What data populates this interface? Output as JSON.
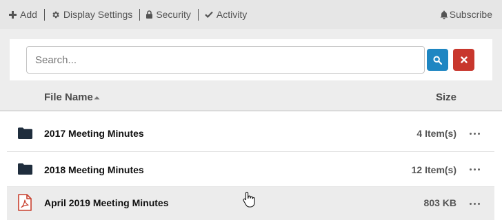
{
  "toolbar": {
    "add_label": "Add",
    "display_settings_label": "Display Settings",
    "security_label": "Security",
    "activity_label": "Activity",
    "subscribe_label": "Subscribe",
    "icons": [
      "plus-icon",
      "gear-icon",
      "lock-icon",
      "check-icon",
      "bell-icon"
    ]
  },
  "search": {
    "placeholder": "Search...",
    "value": ""
  },
  "table": {
    "columns": {
      "name": "File Name",
      "size": "Size",
      "sort": "ascending"
    },
    "rows": [
      {
        "icon": "folder-icon",
        "name": "2017 Meeting Minutes",
        "size": "4 Item(s)"
      },
      {
        "icon": "folder-icon",
        "name": "2018 Meeting Minutes",
        "size": "12 Item(s)"
      },
      {
        "icon": "pdf-file-icon",
        "name": "April 2019 Meeting Minutes",
        "size": "803 KB"
      }
    ]
  },
  "colors": {
    "toolbar_bg": "#e6e6e6",
    "search_button": "#1e86c2",
    "clear_button": "#c8372d",
    "folder_icon": "#1f2d3d",
    "pdf_icon": "#c8402e",
    "hover_row": "#ececec"
  }
}
